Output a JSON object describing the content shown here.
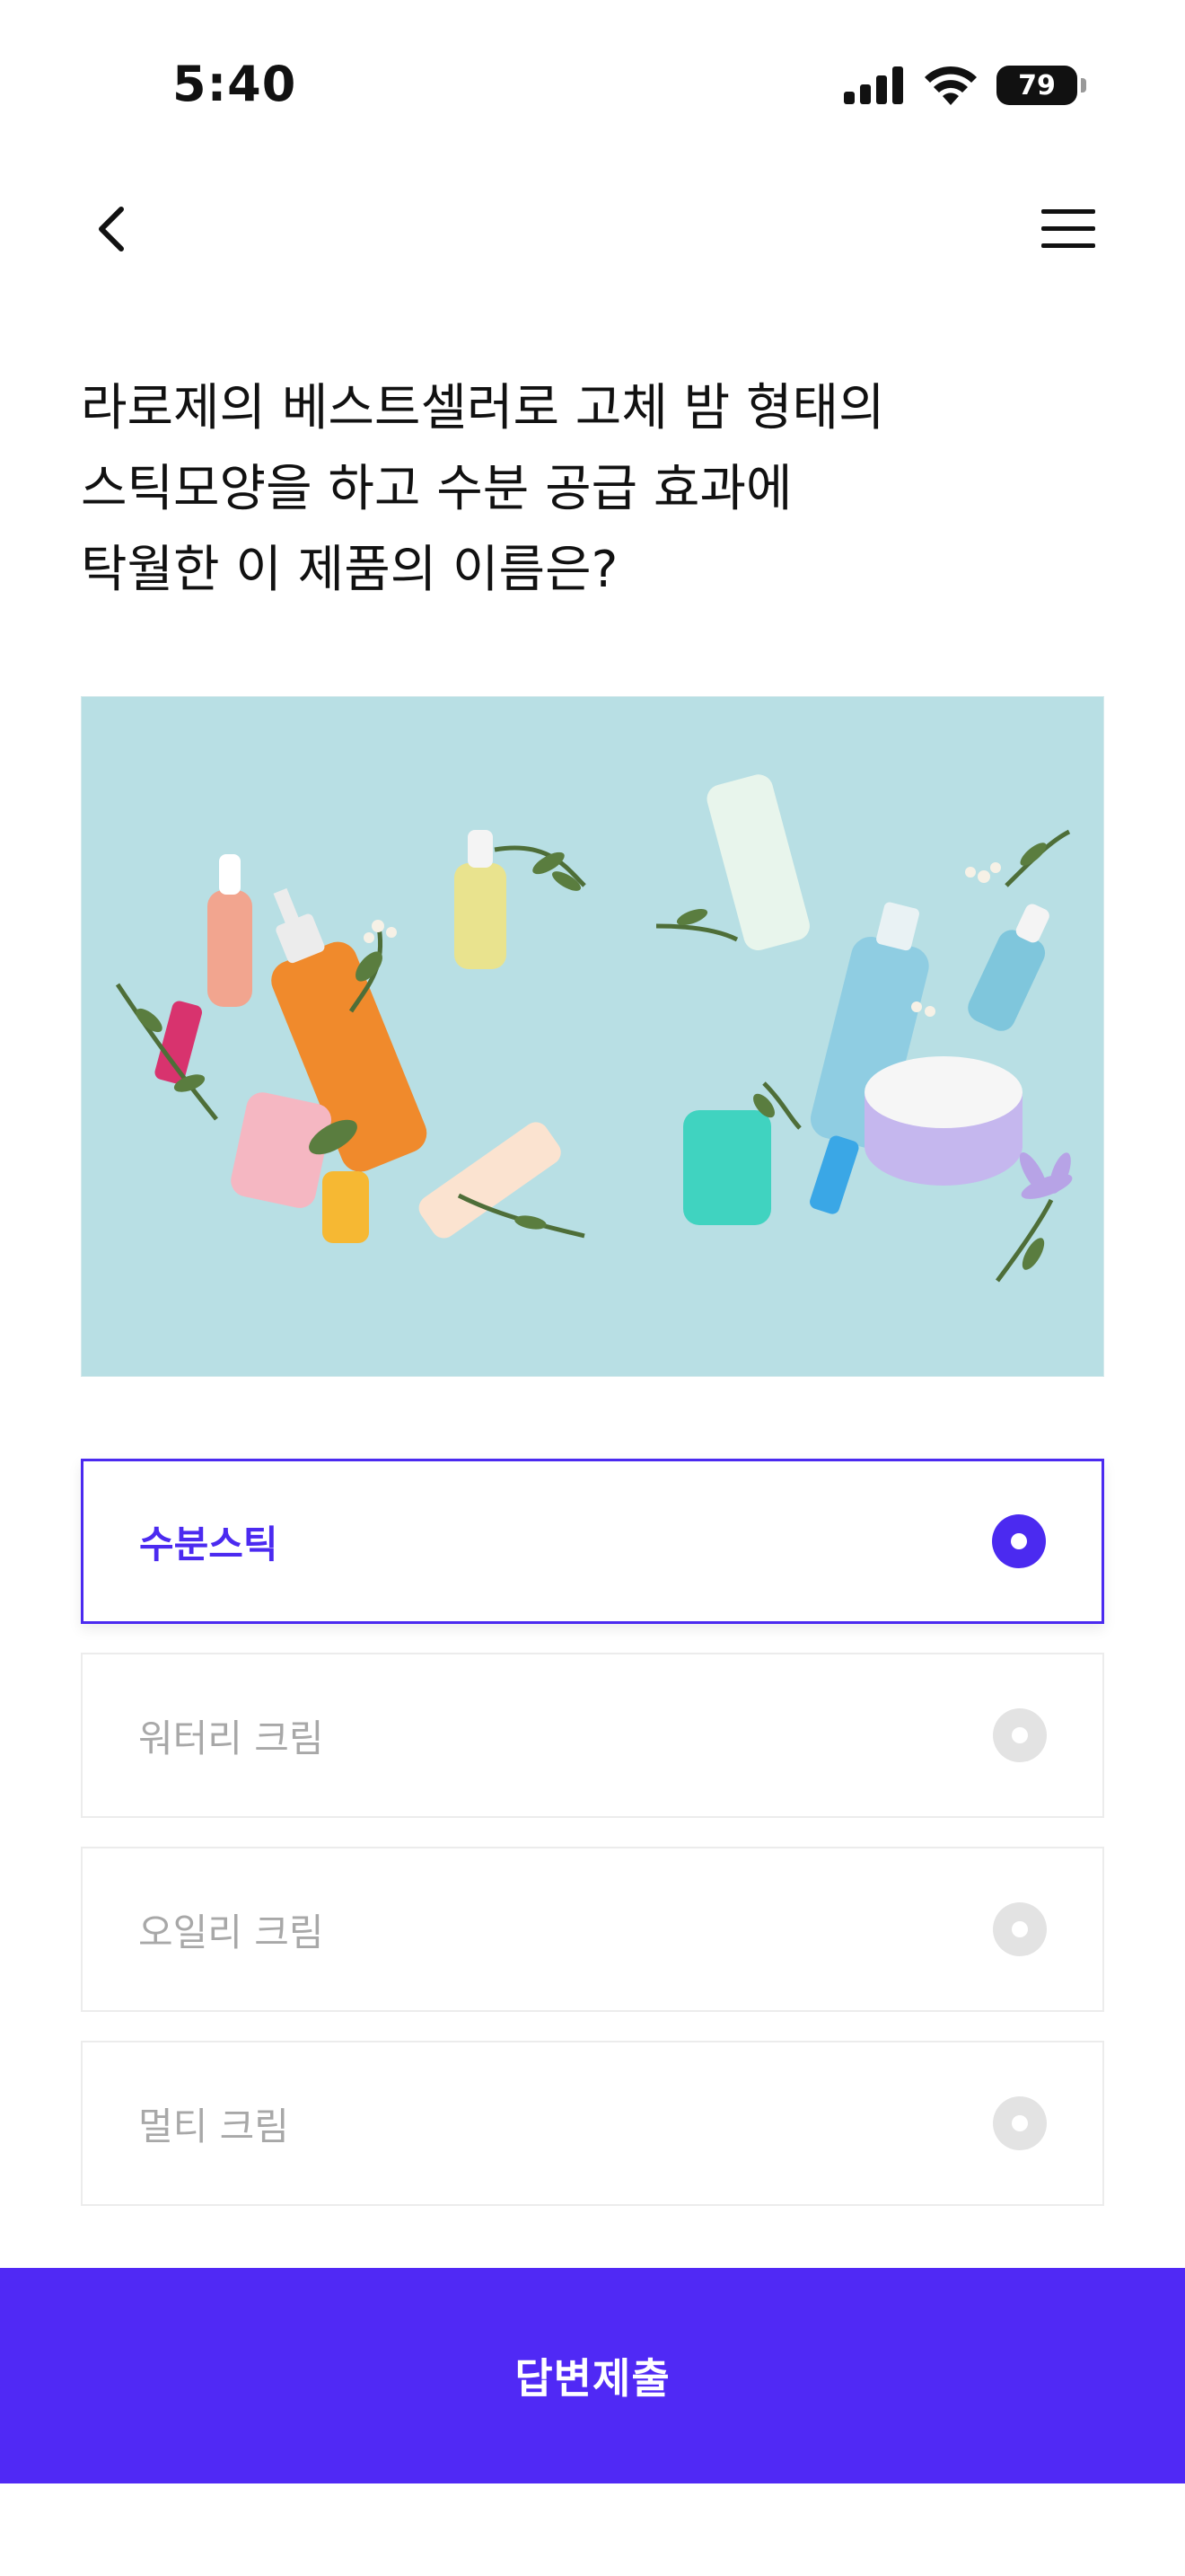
{
  "status_bar": {
    "time": "5:40",
    "battery": "79"
  },
  "nav": {
    "back_icon": "chevron-left-icon",
    "menu_icon": "hamburger-menu-icon"
  },
  "question": {
    "lines": [
      "라로제의 베스트셀러로 고체 밤 형태의",
      "스틱모양을 하고 수분 공급 효과에",
      "탁월한 이 제품의 이름은?"
    ]
  },
  "image": {
    "background_color": "#b7dee3"
  },
  "options": [
    {
      "label": "수분스틱",
      "selected": true
    },
    {
      "label": "워터리 크림",
      "selected": false
    },
    {
      "label": "오일리 크림",
      "selected": false
    },
    {
      "label": "멀티 크림",
      "selected": false
    }
  ],
  "submit": {
    "label": "답변제출"
  },
  "colors": {
    "accent": "#4b2af0",
    "submit_bg": "#5029f5",
    "unselected_text": "#a8a8a8"
  }
}
